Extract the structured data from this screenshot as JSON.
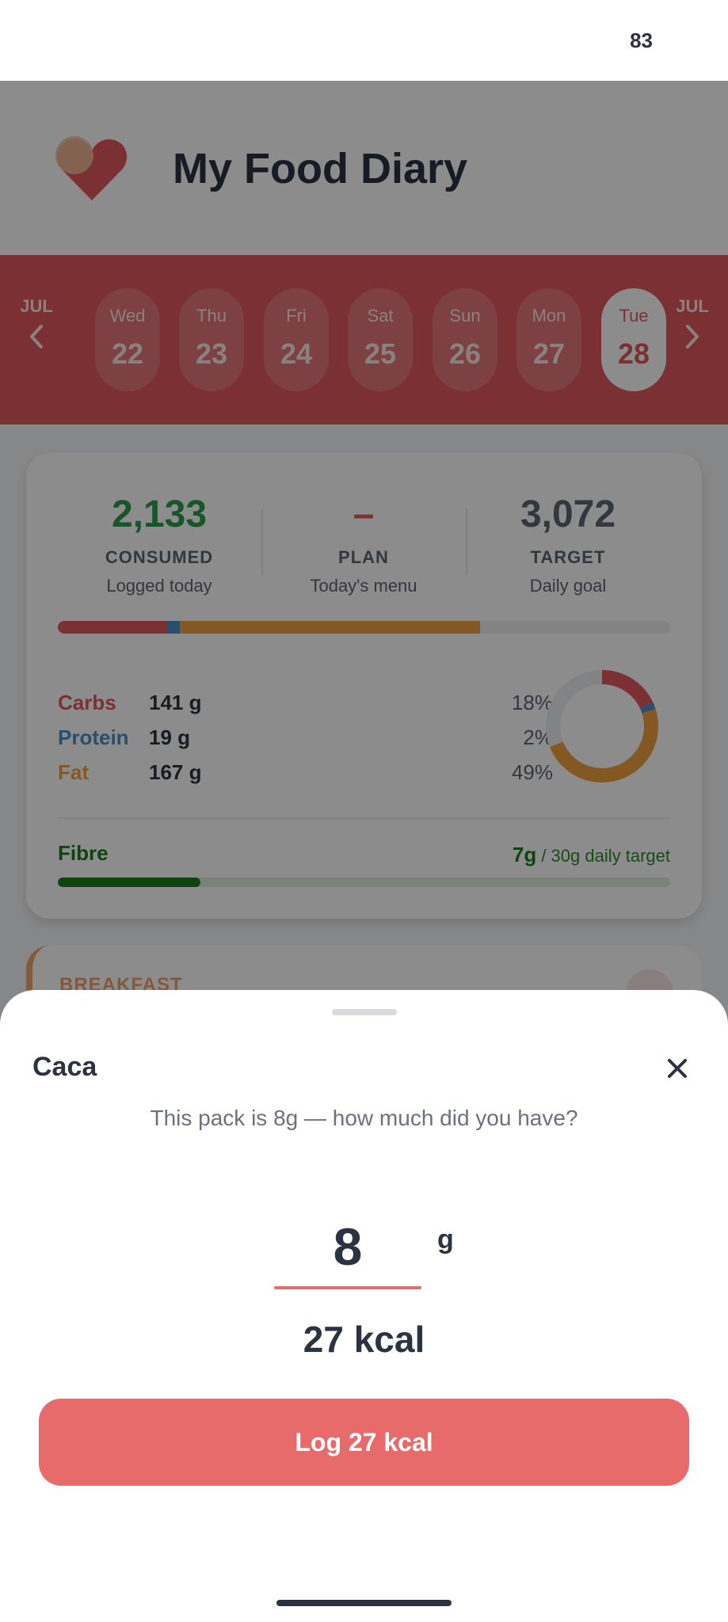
{
  "status_bar": {
    "battery": "83"
  },
  "app": {
    "title": "My Food Diary"
  },
  "colors": {
    "brand": "#e15a5f",
    "carbs": "#e15a5f",
    "protein": "#4a90c8",
    "fat": "#f0a040",
    "fibre": "#1f7a1f",
    "consumed": "#2e9a4e",
    "button": "#e86b6c"
  },
  "date_strip": {
    "prev_month": "JUL",
    "next_month": "JUL",
    "days": [
      {
        "name": "Wed",
        "num": "22"
      },
      {
        "name": "Thu",
        "num": "23"
      },
      {
        "name": "Fri",
        "num": "24"
      },
      {
        "name": "Sat",
        "num": "25"
      },
      {
        "name": "Sun",
        "num": "26"
      },
      {
        "name": "Mon",
        "num": "27"
      },
      {
        "name": "Tue",
        "num": "28",
        "selected": true
      }
    ]
  },
  "summary": {
    "consumed": {
      "value": "2,133",
      "label": "CONSUMED",
      "sub": "Logged today"
    },
    "plan": {
      "value": "–",
      "label": "PLAN",
      "sub": "Today's menu"
    },
    "target": {
      "value": "3,072",
      "label": "TARGET",
      "sub": "Daily goal"
    },
    "calorie_bar_fraction": {
      "carbs": 0.18,
      "protein": 0.02,
      "fat": 0.49
    },
    "macros": [
      {
        "name": "Carbs",
        "amount": "141 g",
        "pct": "18%",
        "fraction": 0.18,
        "color": "#e15a5f"
      },
      {
        "name": "Protein",
        "amount": "19 g",
        "pct": "2%",
        "fraction": 0.02,
        "color": "#4a90c8"
      },
      {
        "name": "Fat",
        "amount": "167 g",
        "pct": "49%",
        "fraction": 0.49,
        "color": "#f0a040"
      }
    ],
    "fibre": {
      "label": "Fibre",
      "value": "7g",
      "target_text": " / 30g daily target",
      "fraction": 0.2333
    }
  },
  "breakfast": {
    "title": "BREAKFAST"
  },
  "sheet": {
    "title": "Caca",
    "subtitle": "This pack is 8g — how much did you have?",
    "amount": "8",
    "unit": "g",
    "kcal": "27 kcal",
    "button_label": "Log 27 kcal",
    "close_icon": "close-icon"
  }
}
